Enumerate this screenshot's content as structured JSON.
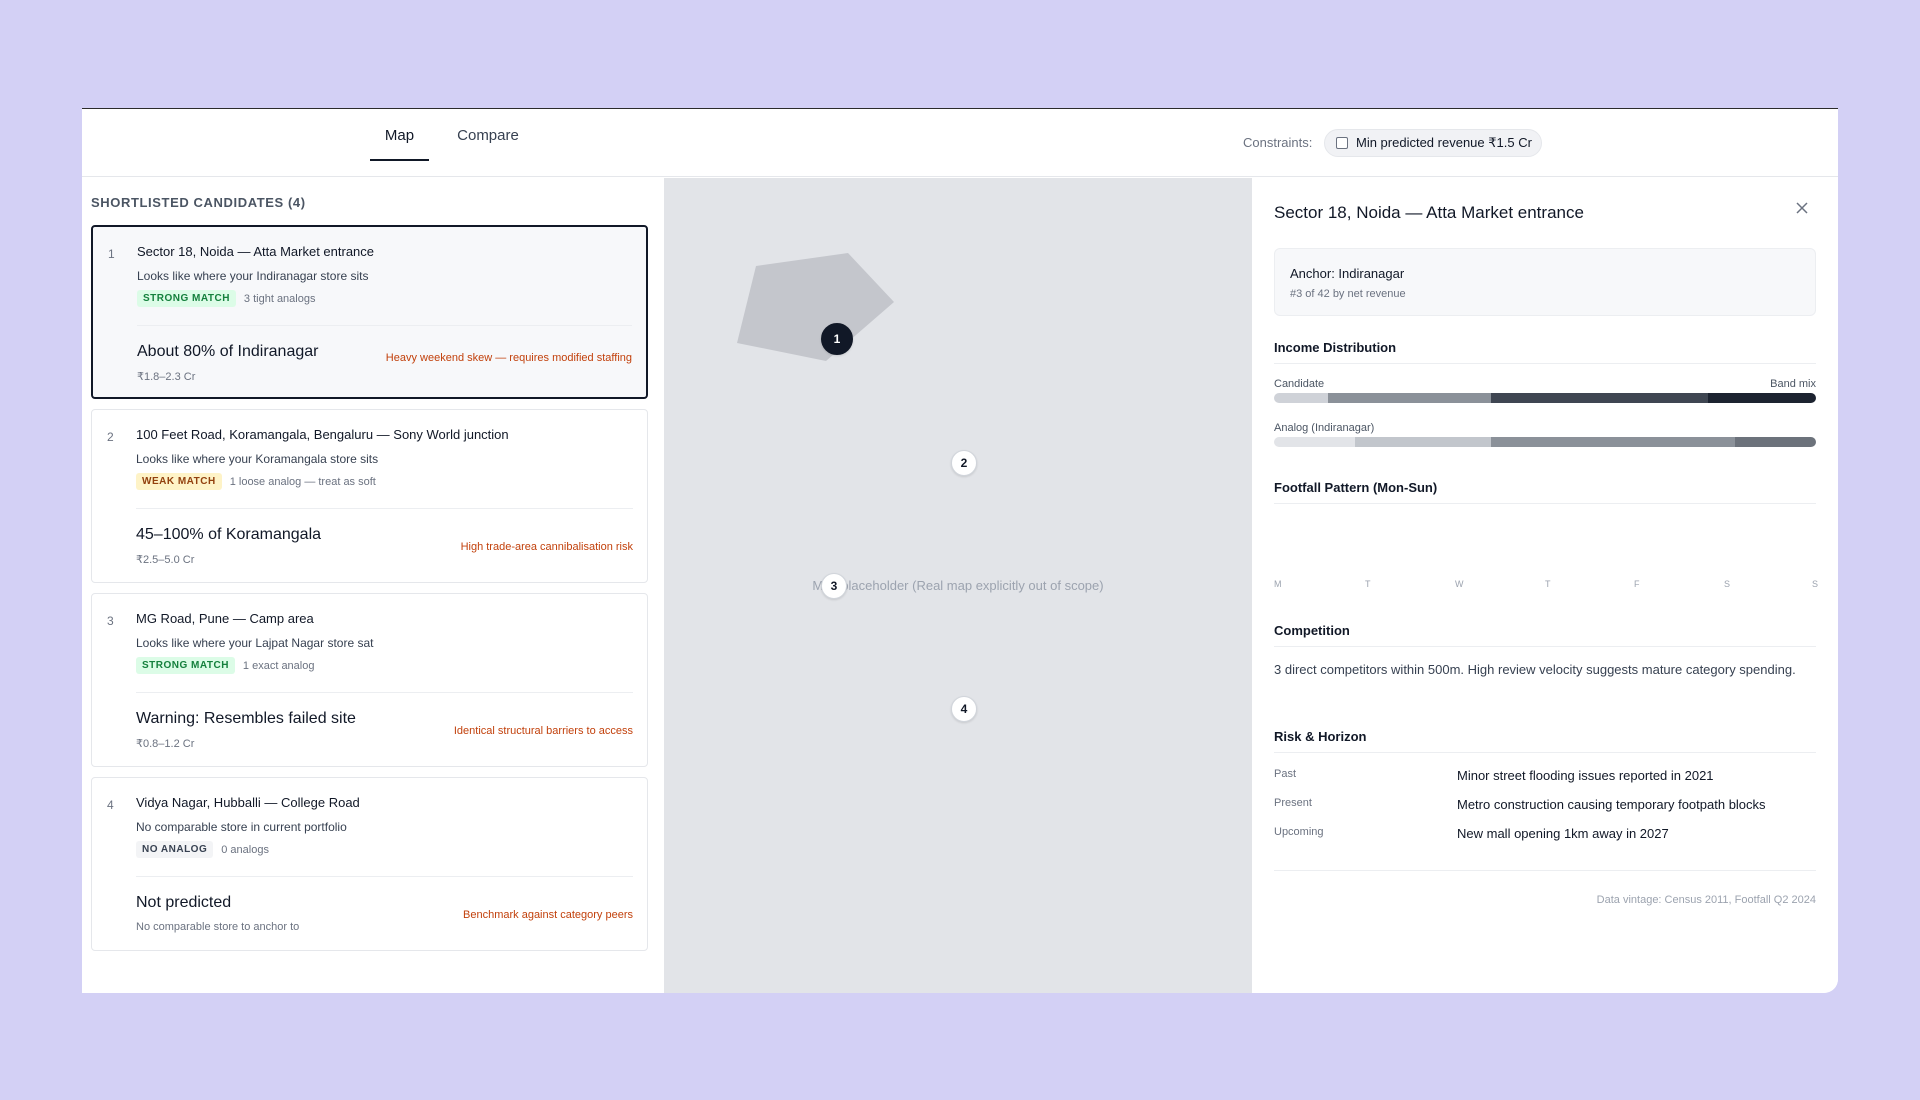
{
  "tabs": [
    {
      "label": "Map",
      "active": true
    },
    {
      "label": "Compare",
      "active": false
    }
  ],
  "constraints": {
    "label": "Constraints:",
    "chip": "Min predicted revenue ₹1.5 Cr",
    "checked": false
  },
  "shortlist": {
    "title": "SHORTLISTED CANDIDATES (4)",
    "candidates": [
      {
        "num": "1",
        "title": "Sector 18, Noida — Atta Market entrance",
        "sub": "Looks like where your Indiranagar store sits",
        "badge": "STRONG MATCH",
        "badge_type": "strong",
        "note": "3 tight analogs",
        "prediction": "About 80% of Indiranagar",
        "range": "₹1.8–2.3 Cr",
        "risk": "Heavy weekend skew — requires modified staffing",
        "selected": true
      },
      {
        "num": "2",
        "title": "100 Feet Road, Koramangala, Bengaluru — Sony World junction",
        "sub": "Looks like where your Koramangala store sits",
        "badge": "WEAK MATCH",
        "badge_type": "weak",
        "note": "1 loose analog — treat as soft",
        "prediction": "45–100% of Koramangala",
        "range": "₹2.5–5.0 Cr",
        "risk": "High trade-area cannibalisation risk",
        "selected": false
      },
      {
        "num": "3",
        "title": "MG Road, Pune — Camp area",
        "sub": "Looks like where your Lajpat Nagar store sat",
        "badge": "STRONG MATCH",
        "badge_type": "strong",
        "note": "1 exact analog",
        "prediction": "Warning: Resembles failed site",
        "range": "₹0.8–1.2 Cr",
        "risk": "Identical structural barriers to access",
        "selected": false
      },
      {
        "num": "4",
        "title": "Vidya Nagar, Hubballi — College Road",
        "sub": "No comparable store in current portfolio",
        "badge": "NO ANALOG",
        "badge_type": "none",
        "note": "0 analogs",
        "prediction": "Not predicted",
        "range": "No comparable store to anchor to",
        "risk": "Benchmark against category peers",
        "selected": false
      }
    ]
  },
  "map": {
    "placeholder": "Map placeholder (Real map explicitly out of scope)",
    "pins": [
      "1",
      "2",
      "3",
      "4"
    ]
  },
  "detail": {
    "title": "Sector 18, Noida — Atta Market entrance",
    "anchor": "Anchor: Indiranagar",
    "anchor_rank": "#3 of 42 by net revenue",
    "income": {
      "title": "Income Distribution",
      "candidate_label": "Candidate",
      "band_mix_label": "Band mix",
      "analog_label": "Analog (Indiranagar)",
      "candidate_bands": [
        10,
        30,
        40,
        20
      ],
      "analog_bands": [
        15,
        25,
        45,
        15
      ],
      "band_colors": [
        "#cfd2d8",
        "#8b9199",
        "#3f4652",
        "#1c2330"
      ],
      "analog_colors": [
        "#e2e4e8",
        "#c2c6cc",
        "#8b9199",
        "#6c727b"
      ]
    },
    "footfall": {
      "title": "Footfall Pattern (Mon-Sun)",
      "days": [
        "M",
        "T",
        "W",
        "T",
        "F",
        "S",
        "S"
      ]
    },
    "competition": {
      "title": "Competition",
      "text": "3 direct competitors within 500m. High review velocity suggests mature category spending."
    },
    "risk": {
      "title": "Risk & Horizon",
      "rows": [
        {
          "key": "Past",
          "value": "Minor street flooding issues reported in 2021"
        },
        {
          "key": "Present",
          "value": "Metro construction causing temporary footpath blocks"
        },
        {
          "key": "Upcoming",
          "value": "New mall opening 1km away in 2027"
        }
      ]
    },
    "vintage": "Data vintage: Census 2011, Footfall Q2 2024"
  }
}
